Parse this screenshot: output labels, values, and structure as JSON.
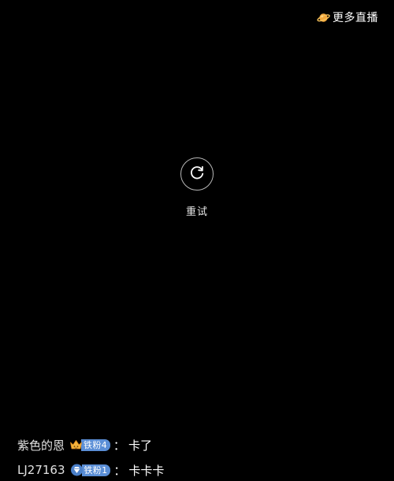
{
  "more_live": {
    "label": "更多直播",
    "icon": "planet-icon",
    "icon_color": "#f3a73b"
  },
  "retry": {
    "label": "重试",
    "icon": "refresh-icon"
  },
  "chat": {
    "messages": [
      {
        "user": "紫色的恩",
        "badge_icon": "crown-icon",
        "badge": "铁粉4",
        "separator": "：",
        "text": "卡了"
      },
      {
        "user": "LJ27163",
        "badge_icon": "diamond-icon",
        "badge": "铁粉1",
        "separator": "：",
        "text": "卡卡卡"
      }
    ]
  },
  "colors": {
    "background": "#000000",
    "badge": "#5a8ed6",
    "accent": "#f3a73b"
  }
}
